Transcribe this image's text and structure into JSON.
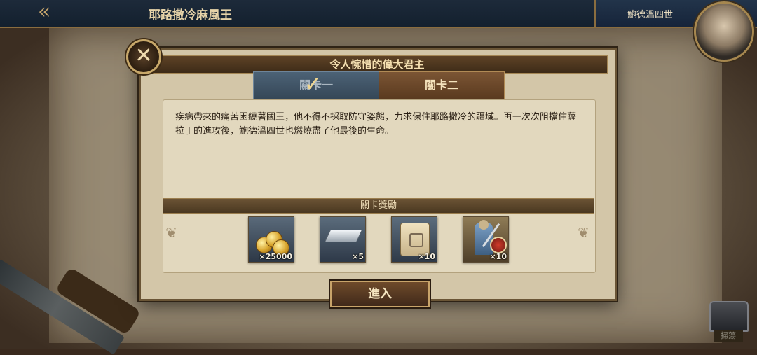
{
  "top_bar": {
    "back_icon": "double-chevron-left",
    "title": "耶路撒冷麻風王",
    "player_name": "鮑德溫四世"
  },
  "dialog": {
    "title": "令人惋惜的偉大君主",
    "tabs": [
      {
        "label": "關卡一",
        "completed": true
      },
      {
        "label": "關卡二",
        "selected": true
      }
    ],
    "story": "疾病帶來的痛苦困繞著國王，他不得不採取防守姿態，力求保住耶路撒冷的疆域。再一次次阻擋住薩拉丁的進攻後，鮑德溫四世也燃燒盡了他最後的生命。",
    "reward_title": "關卡獎勵",
    "rewards": [
      {
        "icon": "gold-coins-icon",
        "qty": "×25000"
      },
      {
        "icon": "silver-ingot-icon",
        "qty": "×5"
      },
      {
        "icon": "scroll-icon",
        "qty": "×10"
      },
      {
        "icon": "soldier-icon",
        "qty": "×10"
      }
    ],
    "enter_label": "進入"
  },
  "chest_label": "掃蕩",
  "colors": {
    "accent_gold": "#c8a46a",
    "tab_active": "#7b5534",
    "tab_done": "#4c6276",
    "parchment": "#d3c6a8"
  }
}
